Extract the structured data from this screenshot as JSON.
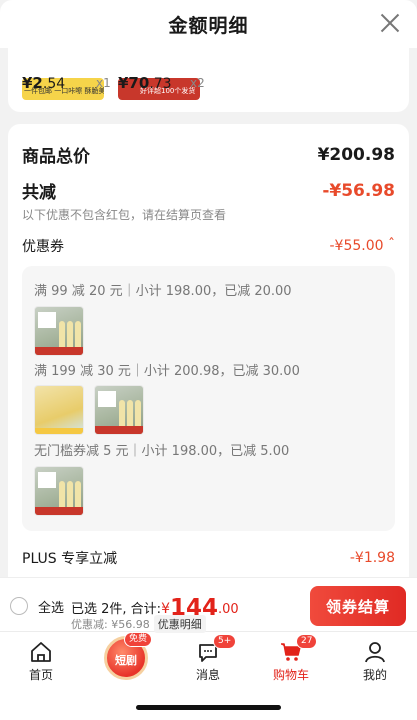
{
  "header": {
    "title": "金额明细"
  },
  "top_products": [
    {
      "price_int": "¥2",
      "price_dec": ".54",
      "qty": "x1",
      "banner": "一件包邮  一口咔嚓  酥脆美味"
    },
    {
      "price_int": "¥70",
      "price_dec": ".73",
      "qty": "x2",
      "banner": "好评超100个发货"
    }
  ],
  "summary": {
    "goods_total_label": "商品总价",
    "goods_total_value": "¥200.98",
    "discount_label": "共减",
    "discount_value": "-¥56.98",
    "hint": "以下优惠不包含红包，请在结算页查看"
  },
  "coupon": {
    "label": "优惠券",
    "value": "-¥55.00",
    "lines": [
      "满 99 减 20 元｜小计 198.00，已减 20.00",
      "满 199 减 30 元｜小计 200.98，已减 30.00",
      "无门槛券减 5 元｜小计 198.00，已减 5.00"
    ]
  },
  "plus": {
    "label": "PLUS 专享立减",
    "value": "-¥1.98"
  },
  "checkout": {
    "select_all": "全选",
    "selected_text": "已选 2件, 合计:",
    "currency": "¥",
    "total_int": "144",
    "total_dec": ".00",
    "discount_text": "优惠减: ¥56.98",
    "detail_chip": "优惠明细",
    "cta": "领券结算"
  },
  "tabbar": {
    "home": "首页",
    "short_drama": "短剧",
    "short_badge": "免费",
    "messages": "消息",
    "messages_badge": "5+",
    "cart": "购物车",
    "cart_badge": "27",
    "mine": "我的"
  },
  "colors": {
    "accent": "#e2231a",
    "coupon_value": "#e84a2b"
  }
}
